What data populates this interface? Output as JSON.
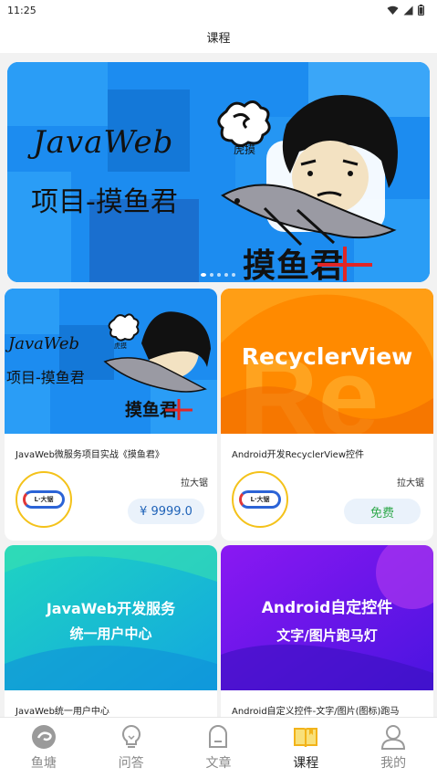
{
  "status_bar": {
    "time": "11:25",
    "icons": [
      "wifi-icon",
      "signal-icon",
      "battery-icon"
    ]
  },
  "header": {
    "title": "课程"
  },
  "banner": {
    "title": "JavaWeb",
    "subtitle": "项目-摸鱼君",
    "sticker_text": "虎摸",
    "stamp": "摸鱼君",
    "dots_count": 5,
    "active_dot": 0
  },
  "courses": [
    {
      "cover": {
        "title": "JavaWeb",
        "subtitle": "项目-摸鱼君",
        "sticker_text": "虎摸",
        "stamp": "摸鱼君"
      },
      "title": "JavaWeb微服务项目实战《摸鱼君》",
      "author": "拉大锯",
      "logo_text": "L·大锯",
      "price": "¥ 9999.0",
      "price_type": "paid"
    },
    {
      "cover": {
        "title": "RecyclerView"
      },
      "title": "Android开发RecyclerView控件",
      "author": "拉大锯",
      "logo_text": "L·大锯",
      "price": "免费",
      "price_type": "free"
    },
    {
      "cover": {
        "line1": "JavaWeb开发服务",
        "line2": "统一用户中心"
      },
      "title": "JavaWeb统一用户中心"
    },
    {
      "cover": {
        "line1": "Android自定控件",
        "line2": "文字/图片跑马灯"
      },
      "title": "Android自定义控件-文字/图片(图标)跑马"
    }
  ],
  "tab_bar": {
    "active_index": 3,
    "tabs": [
      {
        "label": "鱼塘",
        "icon": "fish-pond-icon"
      },
      {
        "label": "问答",
        "icon": "lightbulb-icon"
      },
      {
        "label": "文章",
        "icon": "document-icon"
      },
      {
        "label": "课程",
        "icon": "book-icon"
      },
      {
        "label": "我的",
        "icon": "user-icon"
      }
    ]
  },
  "colors": {
    "banner_blue": "#1c8cf0",
    "orange_cover": "#ff8a00",
    "teal_cover": "#12c9b9",
    "purple_cover": "#6d17ee",
    "paid_price": "#1f63b8",
    "free_price": "#2ea84a",
    "active_tab": "#f2b31a"
  }
}
